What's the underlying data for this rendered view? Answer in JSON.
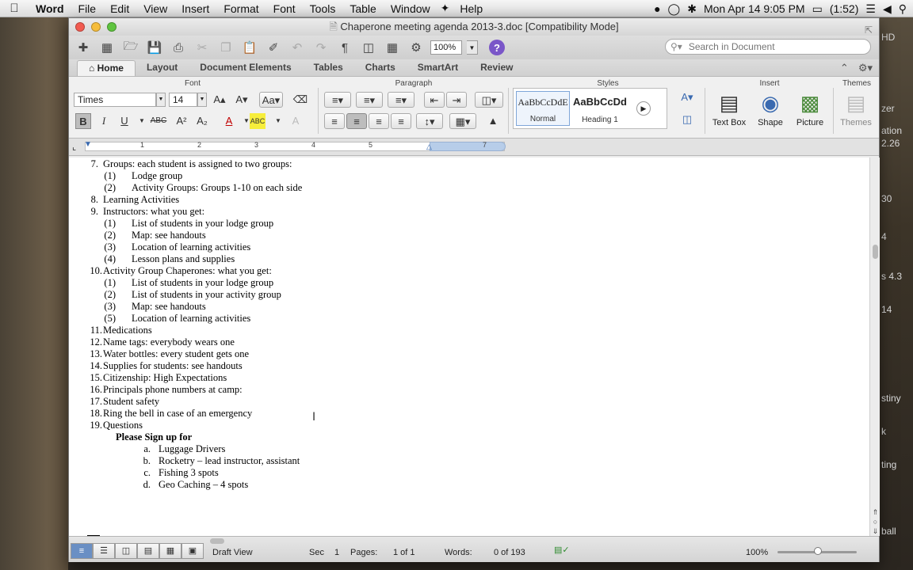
{
  "menubar": {
    "app": "Word",
    "items": [
      "File",
      "Edit",
      "View",
      "Insert",
      "Format",
      "Font",
      "Tools",
      "Table",
      "Window",
      "Help"
    ],
    "clock": "Mon Apr 14  9:05 PM",
    "battery": "(1:52)"
  },
  "desktop": {
    "labels": [
      "HD",
      "zer",
      "ation",
      "2.26",
      "30",
      "4",
      "s 4.3",
      "14",
      "stiny",
      "k",
      "ting",
      "ball"
    ]
  },
  "window": {
    "title": "Chaperone meeting agenda 2013-3.doc [Compatibility Mode]"
  },
  "toolbar": {
    "zoom": "100%",
    "search_placeholder": "Search in Document"
  },
  "tabs": [
    "Home",
    "Layout",
    "Document Elements",
    "Tables",
    "Charts",
    "SmartArt",
    "Review"
  ],
  "ribbon": {
    "groups": {
      "font": "Font",
      "paragraph": "Paragraph",
      "styles": "Styles",
      "insert": "Insert",
      "themes": "Themes"
    },
    "font_name": "Times",
    "font_size": "14",
    "styles": [
      {
        "preview": "AaBbCcDdE",
        "name": "Normal"
      },
      {
        "preview": "AaBbCcDd",
        "name": "Heading 1"
      }
    ],
    "insert_items": [
      "Text Box",
      "Shape",
      "Picture"
    ],
    "themes_label": "Themes"
  },
  "ruler": {
    "marks": [
      "1",
      "2",
      "3",
      "4",
      "5",
      "7"
    ]
  },
  "document": {
    "lines": [
      {
        "num": "7.",
        "text": "Groups: each student is assigned to two groups:"
      },
      {
        "num": "(1)",
        "text": "Lodge group"
      },
      {
        "num": "(2)",
        "text": "Activity Groups: Groups 1-10 on each side"
      },
      {
        "num": "8.",
        "text": "Learning Activities"
      },
      {
        "num": "9.",
        "text": "Instructors: what you get:"
      },
      {
        "num": "(1)",
        "text": "List of students in your lodge group"
      },
      {
        "num": "(2)",
        "text": "Map: see handouts"
      },
      {
        "num": "(3)",
        "text": "Location of learning activities"
      },
      {
        "num": "(4)",
        "text": "Lesson plans and supplies"
      },
      {
        "num": "10.",
        "text": "Activity Group Chaperones: what you get:"
      },
      {
        "num": "(1)",
        "text": "List of students in your lodge group"
      },
      {
        "num": "(2)",
        "text": "List of students in your activity group"
      },
      {
        "num": "(3)",
        "text": "Map: see handouts"
      },
      {
        "num": "(5)",
        "text": "Location of learning activities"
      },
      {
        "num": "11.",
        "text": " Medications"
      },
      {
        "num": "12.",
        "text": " Name tags: everybody wears one"
      },
      {
        "num": "13.",
        "text": " Water bottles: every student gets one"
      },
      {
        "num": "14.",
        "text": " Supplies for students: see handouts"
      },
      {
        "num": "15.",
        "text": "Citizenship: High Expectations"
      },
      {
        "num": "16.",
        "text": " Principals phone numbers at camp:"
      },
      {
        "num": "17.",
        "text": "Student safety"
      },
      {
        "num": "18.",
        "text": "Ring the bell in case of an emergency"
      },
      {
        "num": "19.",
        "text": " Questions"
      },
      {
        "num": "",
        "text": "Please Sign up for"
      },
      {
        "num": "a.",
        "text": "Luggage Drivers"
      },
      {
        "num": "b.",
        "text": "Rocketry – lead instructor, assistant"
      },
      {
        "num": "c.",
        "text": "Fishing 3 spots"
      },
      {
        "num": "d.",
        "text": "Geo Caching – 4 spots"
      }
    ]
  },
  "status": {
    "view": "Draft View",
    "sec_label": "Sec",
    "sec_value": "1",
    "pages_label": "Pages:",
    "pages_value": "1 of 1",
    "words_label": "Words:",
    "words_value": "0 of 193",
    "zoom": "100%"
  }
}
